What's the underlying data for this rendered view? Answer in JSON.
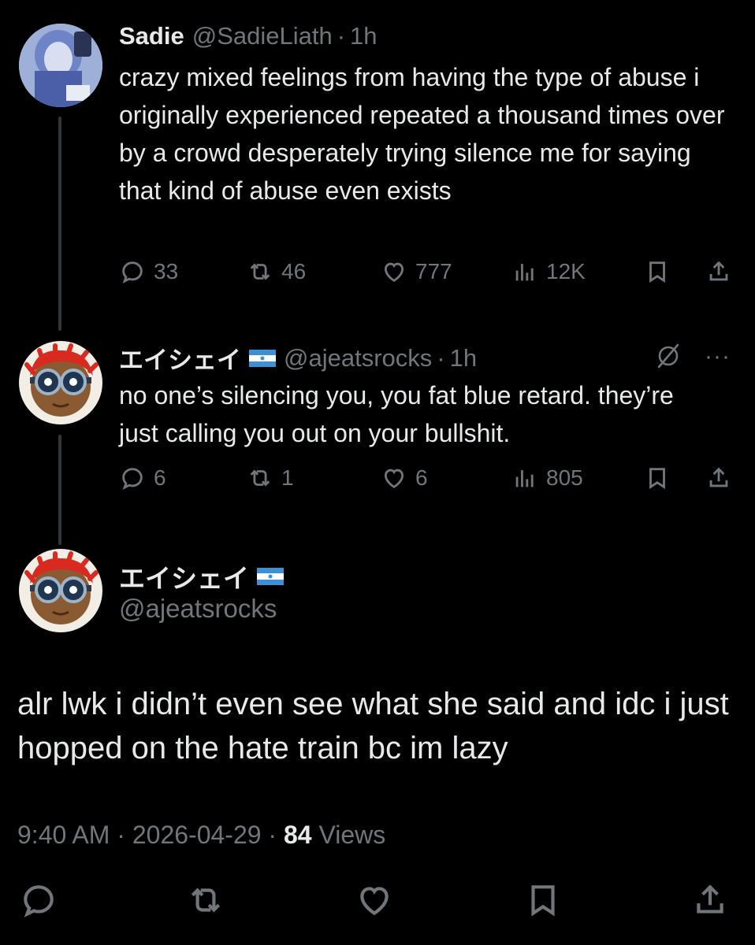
{
  "parent_tweet": {
    "name": "Sadie",
    "handle": "@SadieLiath",
    "separator": "·",
    "time": "1h",
    "text": "crazy mixed feelings from having the type of abuse i originally experienced repeated a thousand times over by a crowd desperately trying silence me for saying that kind of abuse even exists",
    "replies": "33",
    "reposts": "46",
    "likes": "777",
    "views": "12K"
  },
  "reply_tweet": {
    "name": "エイシェイ",
    "handle": "@ajeatsrocks",
    "separator": "·",
    "time": "1h",
    "text": "no one’s silencing you, you fat blue retard. they’re just calling you out on your bullshit.",
    "replies": "6",
    "reposts": "1",
    "likes": "6",
    "views": "805",
    "more": "···"
  },
  "main_tweet": {
    "name": "エイシェイ",
    "handle": "@ajeatsrocks",
    "text": "alr lwk i didn’t even see what she said and idc i just hopped on the hate train bc im lazy",
    "time": "9:40 AM",
    "separator": "·",
    "date": "2026-04-29",
    "separator2": "·",
    "views_count": "84",
    "views_label": "Views"
  },
  "icons": {
    "reply": "reply-icon",
    "repost": "repost-icon",
    "like": "heart-icon",
    "views": "views-chart-icon",
    "bookmark": "bookmark-icon",
    "share": "share-icon",
    "grok": "grok-icon",
    "more": "more-icon",
    "flag": "nicaragua-flag-icon"
  },
  "colors": {
    "background": "#000000",
    "text": "#e7e9ea",
    "secondary": "#71767b",
    "flag_blue": "#3d8fd6"
  }
}
